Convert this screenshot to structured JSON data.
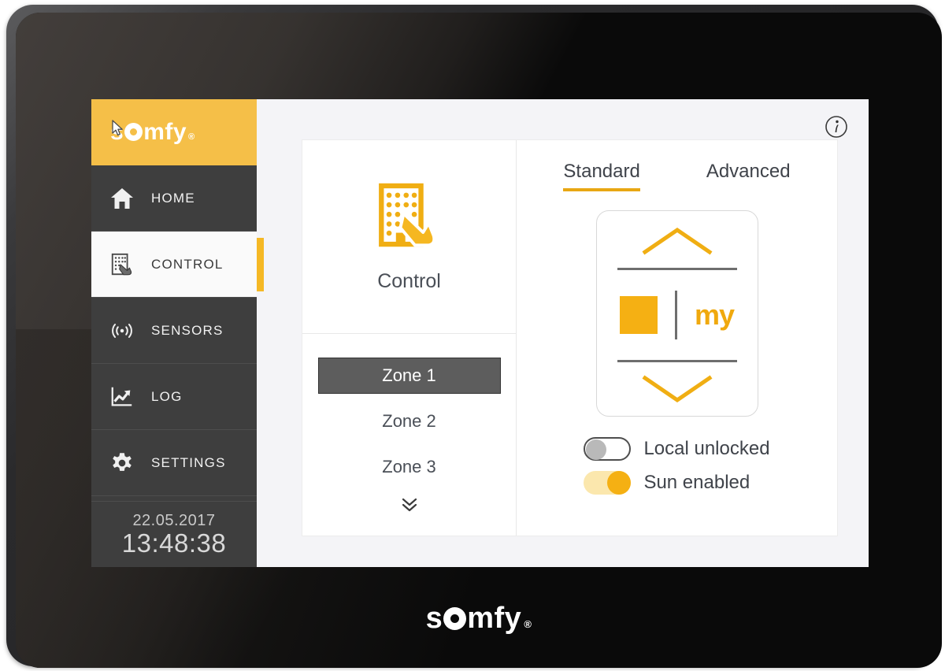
{
  "device": {
    "brand_logo": "somfy",
    "brand_registered": "®",
    "bottom_logo": "somfy",
    "bottom_registered": "®"
  },
  "sidebar": {
    "logo_text": "somfy",
    "logo_registered": "®",
    "items": [
      {
        "label": "HOME",
        "icon": "home-icon",
        "active": false
      },
      {
        "label": "CONTROL",
        "icon": "control-icon",
        "active": true
      },
      {
        "label": "SENSORS",
        "icon": "sensor-icon",
        "active": false
      },
      {
        "label": "LOG",
        "icon": "chart-icon",
        "active": false
      },
      {
        "label": "SETTINGS",
        "icon": "gear-icon",
        "active": false
      }
    ],
    "clock": {
      "date": "22.05.2017",
      "time": "13:48:38"
    }
  },
  "content": {
    "info_icon": "info-icon",
    "panel": {
      "icon": "control-building-hand-icon",
      "title": "Control"
    },
    "zones": [
      {
        "label": "Zone 1",
        "selected": true
      },
      {
        "label": "Zone 2",
        "selected": false
      },
      {
        "label": "Zone 3",
        "selected": false
      }
    ],
    "zone_more_icon": "double-chevron-down-icon",
    "tabs": [
      {
        "label": "Standard",
        "active": true
      },
      {
        "label": "Advanced",
        "active": false
      }
    ],
    "remote": {
      "up_icon": "chevron-up-icon",
      "stop_icon": "stop-square-icon",
      "my_label": "my",
      "down_icon": "chevron-down-icon"
    },
    "toggles": [
      {
        "label": "Local unlocked",
        "state": "off"
      },
      {
        "label": "Sun enabled",
        "state": "on"
      }
    ]
  },
  "colors": {
    "accent": "#f5b825",
    "accent_soft": "#f5bf48",
    "sidebar_bg": "#3e3e3e",
    "screen_bg": "#f4f4f7",
    "selected_zone": "#5d5d5d",
    "text_dark": "#3f434a"
  }
}
